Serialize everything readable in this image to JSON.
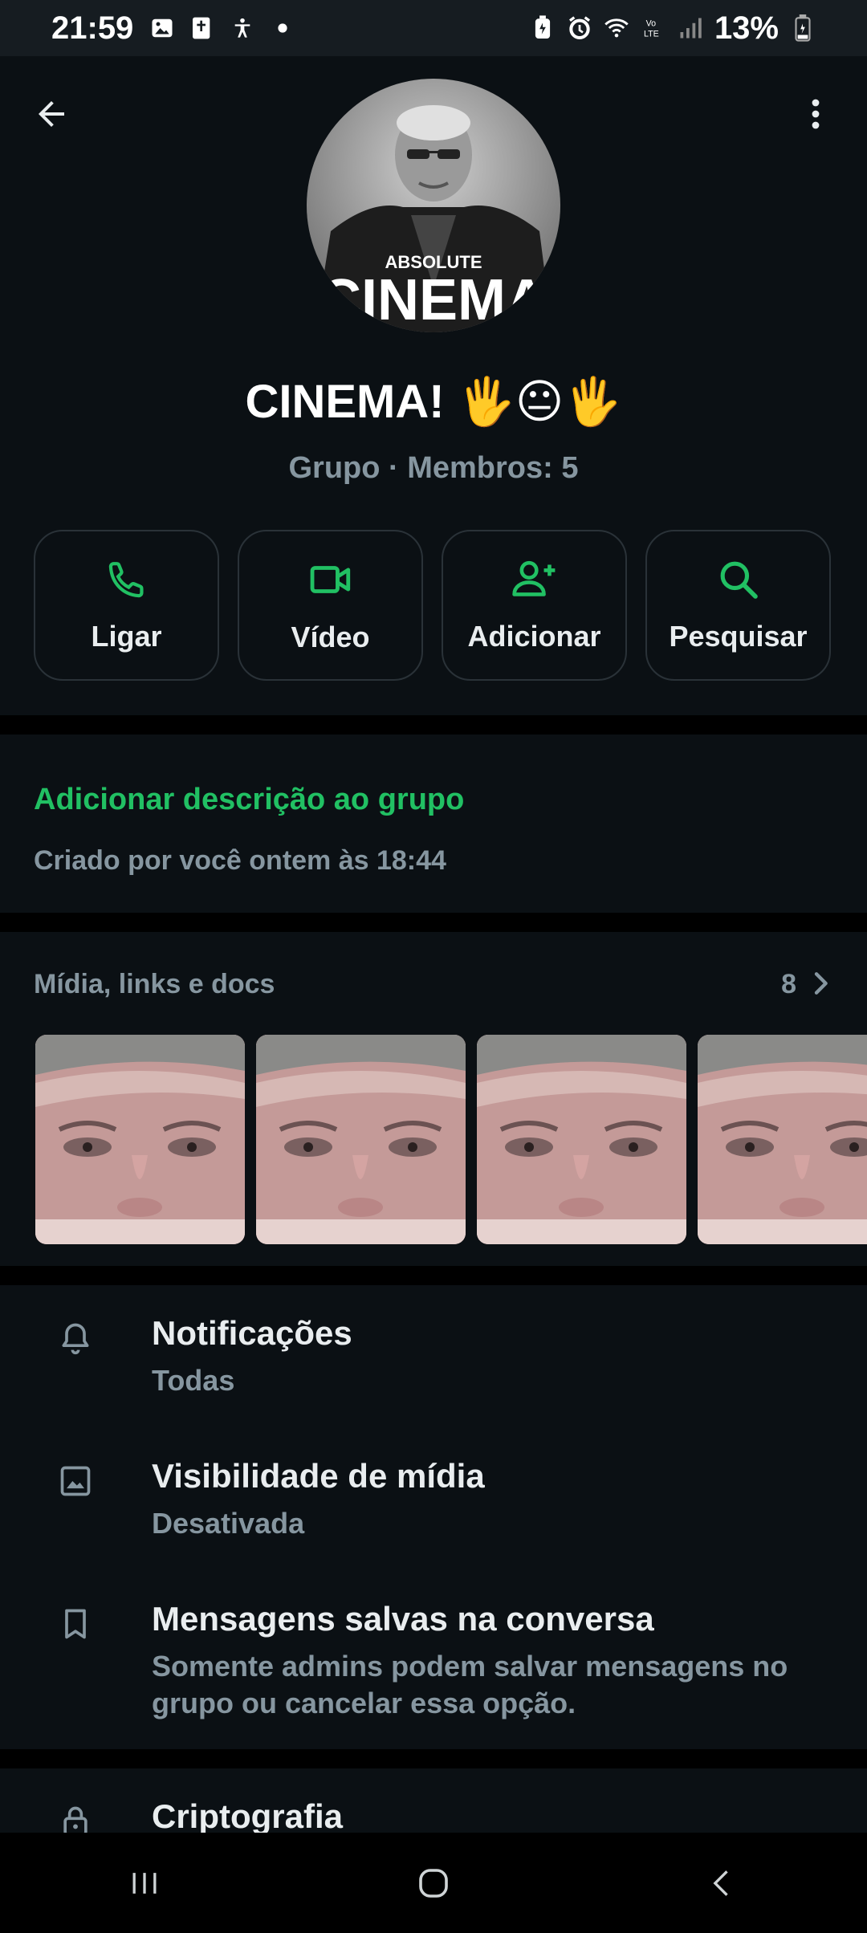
{
  "status_bar": {
    "time": "21:59",
    "battery": "13%",
    "left_icons": [
      "gallery-icon",
      "bible-icon",
      "accessibility-icon",
      "dot-icon"
    ],
    "right_icons": [
      "battery-saver-icon",
      "alarm-icon",
      "wifi-icon",
      "volte-icon",
      "signal-icon",
      "battery-icon"
    ]
  },
  "header": {
    "title": "CINEMA! 🖐😐🖐",
    "subtitle": "Grupo · Membros: 5",
    "avatar_text_small": "ABSOLUTE",
    "avatar_text_big": "CINEMA",
    "actions": [
      {
        "label": "Ligar",
        "icon": "phone-icon"
      },
      {
        "label": "Vídeo",
        "icon": "video-icon"
      },
      {
        "label": "Adicionar",
        "icon": "add-person-icon"
      },
      {
        "label": "Pesquisar",
        "icon": "search-icon"
      }
    ]
  },
  "description": {
    "add_link": "Adicionar descrição ao grupo",
    "created": "Criado por você ontem às 18:44"
  },
  "media": {
    "title": "Mídia, links e docs",
    "count": "8"
  },
  "settings": [
    {
      "title": "Notificações",
      "subtitle": "Todas",
      "icon": "bell-icon"
    },
    {
      "title": "Visibilidade de mídia",
      "subtitle": "Desativada",
      "icon": "image-icon"
    },
    {
      "title": "Mensagens salvas na conversa",
      "subtitle": "Somente admins podem salvar mensagens no grupo ou cancelar essa opção.",
      "icon": "bookmark-icon"
    },
    {
      "title": "Criptografia",
      "icon": "lock-icon"
    }
  ],
  "colors": {
    "accent": "#21c063",
    "background": "#0b1014",
    "text_primary": "#e9edef",
    "text_secondary": "#8696a0"
  }
}
